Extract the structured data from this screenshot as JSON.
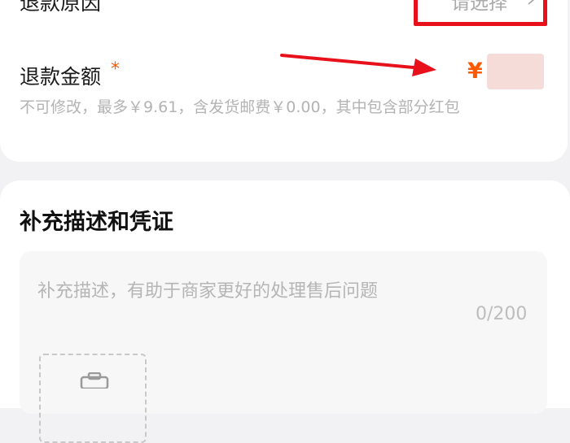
{
  "refund_reason": {
    "label": "退款原因",
    "required_mark": "*",
    "placeholder": "请选择"
  },
  "refund_amount": {
    "label": "退款金额",
    "required_mark": "*",
    "currency": "¥",
    "hint": "不可修改，最多￥9.61，含发货邮费￥0.00，其中包含部分红包"
  },
  "supplement": {
    "title": "补充描述和凭证",
    "placeholder": "补充描述，有助于商家更好的处理售后问题",
    "counter": "0/200"
  },
  "colors": {
    "accent": "#ff5a00",
    "highlight_box": "#e8101a",
    "annotation_arrow": "#e8101a"
  },
  "icons": {
    "chevron": "chevron-right-icon",
    "upload": "camera-icon"
  }
}
